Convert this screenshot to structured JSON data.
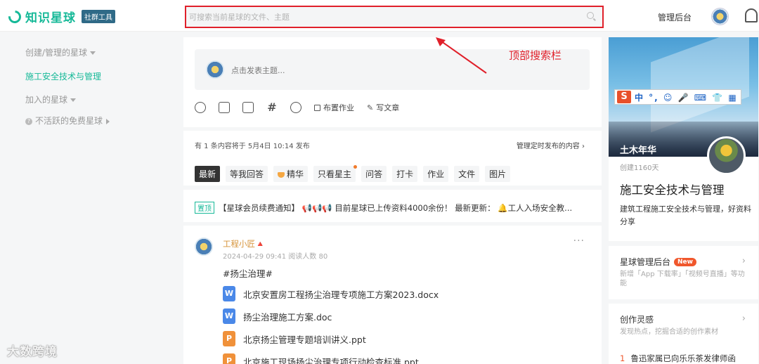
{
  "header": {
    "logo_text": "知识星球",
    "logo_badge": "社群工具",
    "search_placeholder": "可搜索当前星球的文件、主题",
    "admin_link": "管理后台"
  },
  "sidebar": {
    "created_group": "创建/管理的星球",
    "active_group": "施工安全技术与管理",
    "joined_group": "加入的星球",
    "inactive_group": "不活跃的免费星球"
  },
  "watermark": "大数跨境",
  "compose": {
    "placeholder": "点击发表主题...",
    "assign_label": "布置作业",
    "write_label": "写文章"
  },
  "schedule": {
    "text": "有 1 条内容将于 5月4日 10:14 发布",
    "link": "管理定时发布的内容"
  },
  "tabs": [
    {
      "label": "最新"
    },
    {
      "label": "等我回答"
    },
    {
      "label": "精华"
    },
    {
      "label": "只看星主"
    },
    {
      "label": "问答"
    },
    {
      "label": "打卡"
    },
    {
      "label": "作业"
    },
    {
      "label": "文件"
    },
    {
      "label": "图片"
    }
  ],
  "pinned": {
    "badge": "置顶",
    "text": "【星球会员续费通知】 📢📢📢 目前星球已上传资料4000余份！ 最新更新： 🔔工人入场安全教..."
  },
  "post": {
    "author": "工程小匠🔺",
    "meta": "2024-04-29 09:41  阅读人数 80",
    "tag": "#扬尘治理#",
    "files": [
      {
        "type": "doc",
        "name": "北京安置房工程扬尘治理专项施工方案2023.docx"
      },
      {
        "type": "doc",
        "name": "扬尘治理施工方案.doc"
      },
      {
        "type": "ppt",
        "name": "北京扬尘管理专题培训讲义.ppt"
      },
      {
        "type": "ppt",
        "name": "北京施工现场扬尘治理专项行动检查标准.ppt"
      }
    ]
  },
  "ime": {
    "logo": "S",
    "text": "中 °, ☺ 🎤 ⌨ 👕 ▦"
  },
  "group": {
    "cover_title": "土木年华",
    "created": "创建1160天",
    "name": "施工安全技术与管理",
    "desc": "建筑工程施工安全技术与管理，好资料分享"
  },
  "admin_card": {
    "title": "星球管理后台",
    "badge": "New",
    "sub": "新增「App 下载率」「视频号直播」等功能"
  },
  "inspiration_card": {
    "title": "创作灵感",
    "sub": "发现热点，挖掘合适的创作素材",
    "hot_num": "1",
    "hot_text": "鲁迅家属已向乐乐茶发律师函"
  },
  "annotation": {
    "label": "顶部搜索栏"
  },
  "colors": {
    "brand": "#16b998",
    "highlight_border": "#e0202a",
    "accent": "#f0572c"
  }
}
